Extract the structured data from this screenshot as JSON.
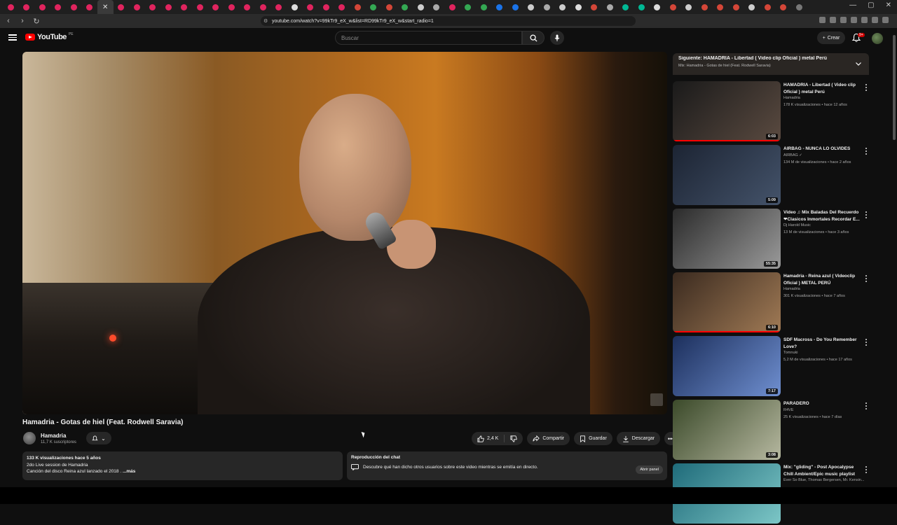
{
  "browser": {
    "url": "youtube.com/watch?v=99kTr9_eX_w&list=RD99kTr9_eX_w&start_radio=1",
    "tab_colors": [
      "#e0245e",
      "#e0245e",
      "#e0245e",
      "#e0245e",
      "#e0245e",
      "#e0245e",
      "#e0245e",
      "#e0245e",
      "#e0245e",
      "#e0245e",
      "#e0245e",
      "#e0245e",
      "#e0245e",
      "#e0245e",
      "#e0245e",
      "#e0245e",
      "#e0245e",
      "#e0245e",
      "#dddddd",
      "#e0245e",
      "#e0245e",
      "#e0245e",
      "#d44638",
      "#34a853",
      "#d44638",
      "#34a853",
      "#cccccc",
      "#aaaaaa",
      "#e0245e",
      "#34a853",
      "#34a853",
      "#1a73e8",
      "#1a73e8",
      "#cccccc",
      "#aaaaaa",
      "#cccccc",
      "#dddddd",
      "#d44638",
      "#aaaaaa",
      "#00b894",
      "#00b894",
      "#dddddd",
      "#d44638",
      "#cccccc",
      "#d44638",
      "#d44638",
      "#d44638",
      "#cccccc",
      "#d44638",
      "#d44638",
      "#777777"
    ],
    "active_tab_index": 6
  },
  "header": {
    "logo_text": "YouTube",
    "country_code": "PE",
    "search_placeholder": "Buscar",
    "create_label": "Crear",
    "notif_badge": "9+"
  },
  "video": {
    "title": "Hamadria - Gotas de hiel (Feat. Rodwell Saravia)",
    "channel": "Hamadria",
    "subscribers": "11,7 K suscriptores",
    "likes": "2,4 K",
    "share_label": "Compartir",
    "save_label": "Guardar",
    "download_label": "Descargar",
    "description": {
      "stats": "133 K visualizaciones  hace 5 años",
      "line1": "2do Live session de Hamadria",
      "line2": "Canción del disco Reina azul lanzado el 2018 .",
      "more": "...más"
    }
  },
  "chat": {
    "title": "Reproducción del chat",
    "text": "Descubre qué han dicho otros usuarios sobre este video mientras se emitía en directo.",
    "button": "Abrir panel"
  },
  "playlist": {
    "next_label": "Siguiente: HAMADRIA - Libertad ( Video clip Oficial ) metal Perú",
    "subtitle": "Mix: Hamadria - Gotas de hiel (Feat. Rodwell Saravia)"
  },
  "recommendations": [
    {
      "title": "HAMADRIA - Libertad ( Video clip Oficial ) metal Perú",
      "channel": "Hamadria",
      "meta": "178 K visualizaciones • hace 12 años",
      "duration": "6:03",
      "progress": 1.0,
      "thumb_colors": [
        "#1a1a1a",
        "#5a4a40"
      ]
    },
    {
      "title": "AIRBAG - NUNCA LO OLVIDES",
      "channel": "AIRBAG ✓",
      "meta": "134 M de visualizaciones • hace 2 años",
      "duration": "5:09",
      "progress": 0,
      "thumb_colors": [
        "#1c2433",
        "#44536a"
      ]
    },
    {
      "title": "Video ♫ Mix Baladas Del Recuerdo ❤Clasicos Inmortales Recordar E...",
      "channel": "Dj Harold Music",
      "meta": "13 M de visualizaciones • hace 3 años",
      "duration": "55:35",
      "progress": 0,
      "thumb_colors": [
        "#2b2b2b",
        "#9a9a9a"
      ]
    },
    {
      "title": "Hamadria - Reina azul ( Videoclip Oficial ) METAL PERÚ",
      "channel": "Hamadria",
      "meta": "301 K visualizaciones • hace 7 años",
      "duration": "6:10",
      "progress": 1.0,
      "thumb_colors": [
        "#3a2a1f",
        "#a07a55"
      ]
    },
    {
      "title": "SDF Macross - Do You Remember Love?",
      "channel": "Tomnuki",
      "meta": "5,2 M de visualizaciones • hace 17 años",
      "duration": "7:17",
      "progress": 0,
      "thumb_colors": [
        "#1c2f5c",
        "#6f8fd0"
      ]
    },
    {
      "title": "PARADERO",
      "channel": "R4VE",
      "meta": "25 K visualizaciones • hace 7 días",
      "duration": "3:08",
      "progress": 0,
      "thumb_colors": [
        "#3b4a2a",
        "#b6b8a0"
      ]
    },
    {
      "title": "Mix: \"gliding\" - Post Apocalypse Chill Ambient/Epic music playlist",
      "channel": "Ever So Blue, Thomas Bergersen, Mr. Kensin...",
      "meta": "",
      "duration": "",
      "progress": 0,
      "thumb_colors": [
        "#1f6b7a",
        "#7cc6c6"
      ]
    }
  ]
}
